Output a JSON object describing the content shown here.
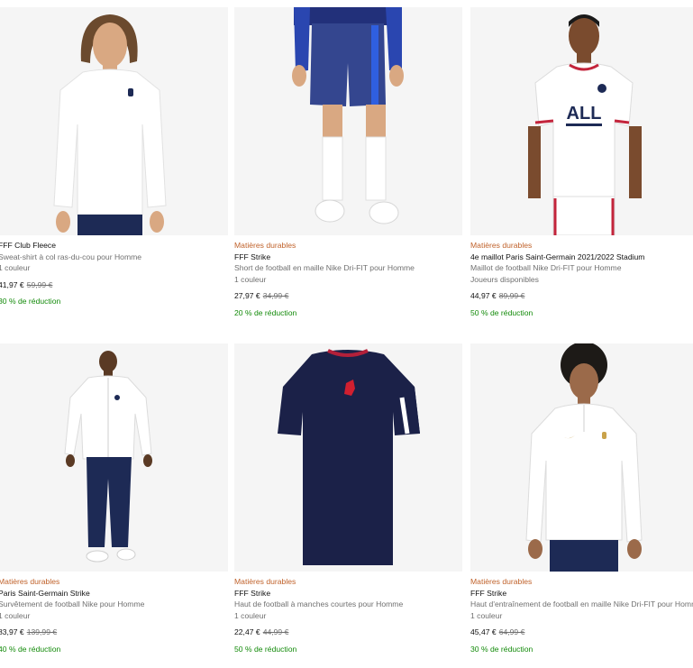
{
  "products": [
    {
      "badge": "",
      "title": "FFF Club Fleece",
      "subtitle": "Sweat-shirt à col ras-du-cou pour Homme",
      "colors": "1 couleur",
      "price": "41,97 €",
      "old_price": "59,99 €",
      "discount": "30 % de réduction",
      "image": "white-sweatshirt"
    },
    {
      "badge": "Matières durables",
      "title": "FFF Strike",
      "subtitle": "Short de football en maille Nike Dri-FIT pour Homme",
      "colors": "1 couleur",
      "price": "27,97 €",
      "old_price": "34,99 €",
      "discount": "20 % de réduction",
      "image": "navy-shorts"
    },
    {
      "badge": "Matières durables",
      "title": "4e maillot Paris Saint-Germain 2021/2022 Stadium",
      "subtitle": "Maillot de football Nike Dri-FIT pour Homme",
      "colors": "Joueurs disponibles",
      "price": "44,97 €",
      "old_price": "89,99 €",
      "discount": "50 % de réduction",
      "image": "psg-white-jersey"
    },
    {
      "badge": "Matières durables",
      "title": "Paris Saint-Germain Strike",
      "subtitle": "Survêtement de football Nike pour Homme",
      "colors": "1 couleur",
      "price": "83,97 €",
      "old_price": "139,99 €",
      "discount": "40 % de réduction",
      "image": "psg-tracksuit"
    },
    {
      "badge": "Matières durables",
      "title": "FFF Strike",
      "subtitle": "Haut de football à manches courtes pour Homme",
      "colors": "1 couleur",
      "price": "22,47 €",
      "old_price": "44,99 €",
      "discount": "50 % de réduction",
      "image": "navy-training-top"
    },
    {
      "badge": "Matières durables",
      "title": "FFF Strike",
      "subtitle": "Haut d'entraînement de football en maille Nike Dri-FIT pour Homme",
      "colors": "1 couleur",
      "price": "45,47 €",
      "old_price": "64,99 €",
      "discount": "30 % de réduction",
      "image": "white-drill-top"
    }
  ],
  "colors": {
    "badge": "#c0622b",
    "discount": "#128a09",
    "muted": "#707070",
    "image_bg": "#f5f5f5",
    "navy": "#1d2a55",
    "red": "#d11f2f"
  }
}
